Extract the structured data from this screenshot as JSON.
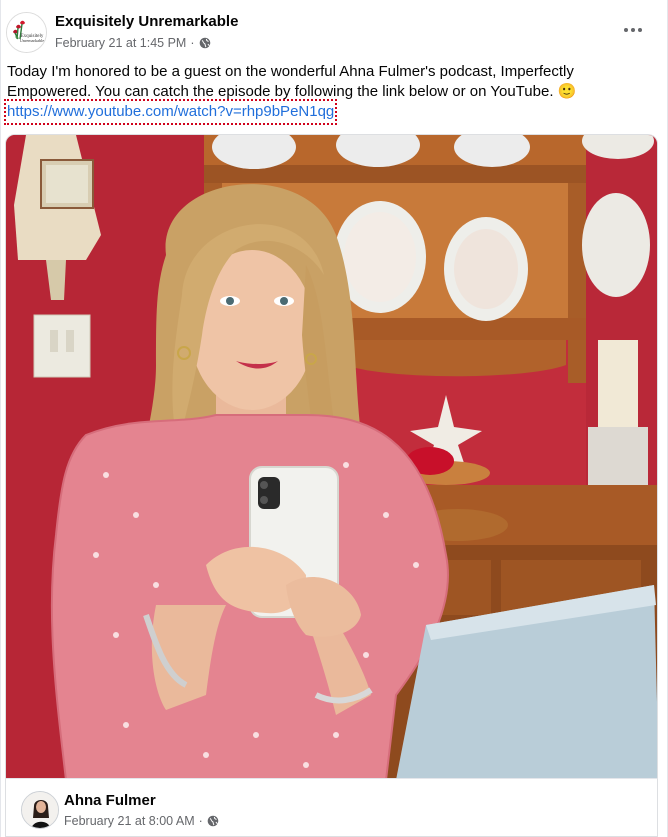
{
  "post": {
    "author": "Exquisitely Unremarkable",
    "timestamp": "February 21 at 1:45 PM",
    "separator": "·",
    "privacy_icon": "globe-icon",
    "more_icon": "more-horizontal-icon",
    "logo_text": "Exquisitely Unremarkable",
    "body_text": "Today I'm honored to be a guest on the wonderful Ahna Fulmer's podcast, Imperfectly Empowered. You can catch the episode by following the link below or on YouTube. 🙂",
    "link": "https://www.youtube.com/watch?v=rhp9bPeN1qg"
  },
  "shared": {
    "author": "Ahna Fulmer",
    "timestamp": "February 21 at 8:00 AM",
    "separator": "·",
    "privacy_icon": "globe-icon"
  },
  "colors": {
    "link": "#216fdb",
    "meta_text": "#65676b",
    "focus_outline": "#d0021b",
    "wall_red": "#c8283a",
    "shelf_wood": "#b86a2c",
    "dress_pink": "#e5848a"
  }
}
